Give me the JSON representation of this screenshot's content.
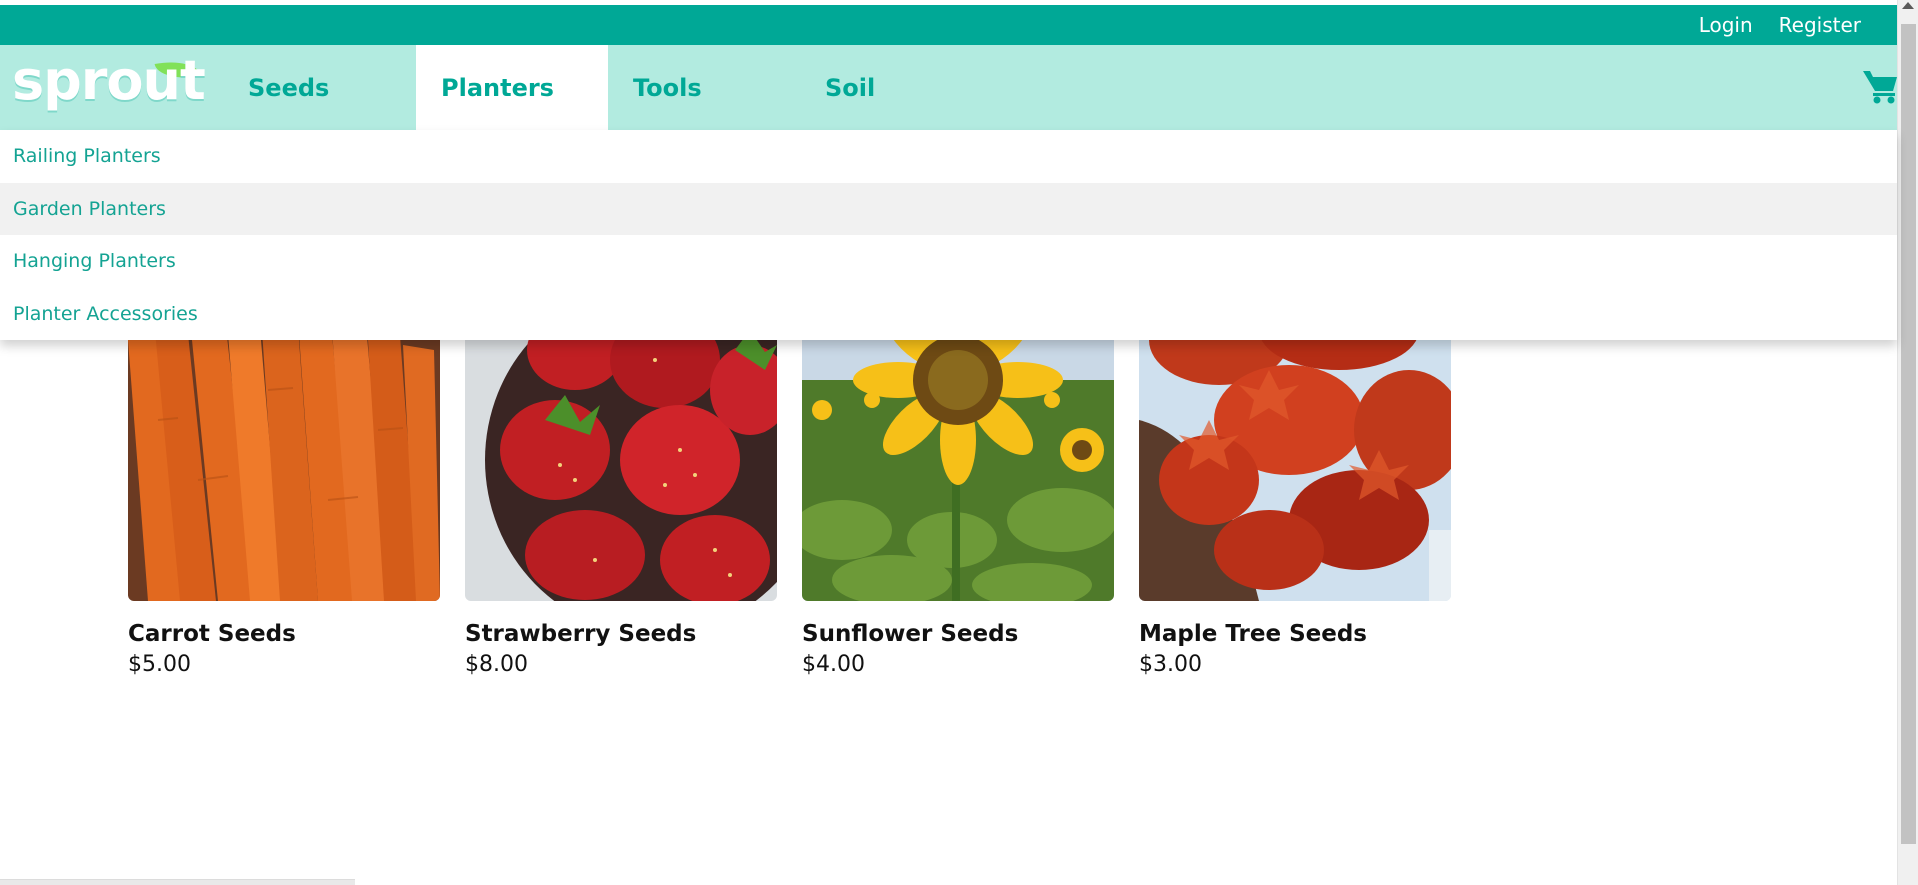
{
  "header": {
    "login_label": "Login",
    "register_label": "Register"
  },
  "brand": {
    "logo_text": "sprout",
    "accent_color": "#00a896",
    "nav_bg_color": "#b2ebe0"
  },
  "nav": {
    "items": [
      {
        "label": "Seeds",
        "active": false
      },
      {
        "label": "Planters",
        "active": true
      },
      {
        "label": "Tools",
        "active": false
      },
      {
        "label": "Soil",
        "active": false
      }
    ],
    "cart_icon": "cart-icon"
  },
  "dropdown": {
    "items": [
      {
        "label": "Railing Planters",
        "hovered": false
      },
      {
        "label": "Garden Planters",
        "hovered": true
      },
      {
        "label": "Hanging Planters",
        "hovered": false
      },
      {
        "label": "Planter Accessories",
        "hovered": false
      }
    ]
  },
  "products": [
    {
      "name": "Carrot Seeds",
      "price": "$5.00",
      "image": "carrots-photo"
    },
    {
      "name": "Strawberry Seeds",
      "price": "$8.00",
      "image": "strawberries-photo"
    },
    {
      "name": "Sunflower Seeds",
      "price": "$4.00",
      "image": "sunflower-photo"
    },
    {
      "name": "Maple Tree Seeds",
      "price": "$3.00",
      "image": "maple-leaves-photo"
    }
  ]
}
